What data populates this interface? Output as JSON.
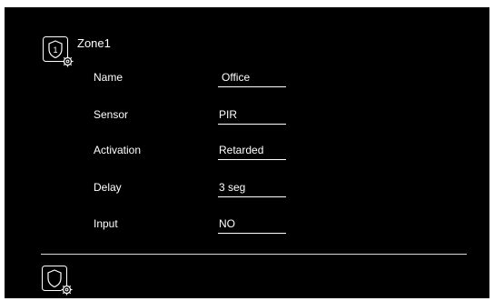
{
  "zone": {
    "title": "Zone1",
    "icon": "shield-settings-icon",
    "badge_number": "1"
  },
  "fields": [
    {
      "label": "Name",
      "value": "Office"
    },
    {
      "label": "Sensor",
      "value": "PIR"
    },
    {
      "label": "Activation",
      "value": "Retarded"
    },
    {
      "label": "Delay",
      "value": "3 seg"
    },
    {
      "label": "Input",
      "value": "NO"
    }
  ],
  "footer": {
    "icon": "shield-settings-icon"
  },
  "colors": {
    "background": "#000000",
    "text": "#ffffff",
    "divider": "#d8d8d8"
  }
}
